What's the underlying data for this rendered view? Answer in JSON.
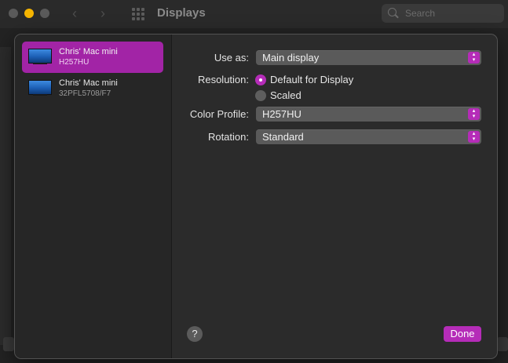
{
  "window": {
    "title": "Displays",
    "search_placeholder": "Search"
  },
  "displays": [
    {
      "name": "Chris' Mac mini",
      "model": "H257HU",
      "selected": true
    },
    {
      "name": "Chris' Mac mini",
      "model": "32PFL5708/F7",
      "selected": false
    }
  ],
  "settings": {
    "use_as_label": "Use as:",
    "use_as_value": "Main display",
    "resolution_label": "Resolution:",
    "resolution_options": [
      "Default for Display",
      "Scaled"
    ],
    "resolution_selected": "Default for Display",
    "color_profile_label": "Color Profile:",
    "color_profile_value": "H257HU",
    "rotation_label": "Rotation:",
    "rotation_value": "Standard"
  },
  "buttons": {
    "help": "?",
    "done": "Done"
  },
  "colors": {
    "accent": "#b52cb8",
    "selection": "#a224a6"
  },
  "icons": [
    "search-icon",
    "grid-icon",
    "monitor-icon",
    "chevron-left-icon",
    "chevron-right-icon",
    "popup-arrows-icon"
  ]
}
